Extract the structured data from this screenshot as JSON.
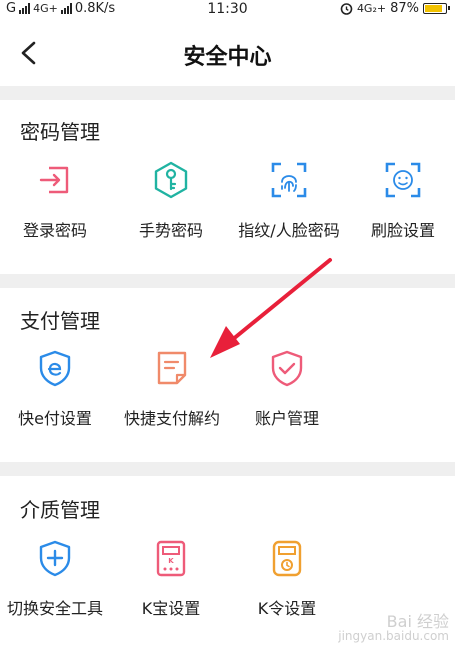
{
  "status": {
    "left_text": "G",
    "network": "4G+",
    "speed": "0.8K/s",
    "time": "11:30",
    "network_right": "4G₂+",
    "battery": "87%",
    "battery_level": 0.87
  },
  "header": {
    "title": "安全中心"
  },
  "sections": [
    {
      "title": "密码管理",
      "items": [
        {
          "label": "登录密码",
          "icon": "login-icon",
          "color": "#ee5b79"
        },
        {
          "label": "手势密码",
          "icon": "key-icon",
          "color": "#20b3a2"
        },
        {
          "label": "指纹/人脸密码",
          "icon": "fingerprint-icon",
          "color": "#2b8be8"
        },
        {
          "label": "刷脸设置",
          "icon": "face-icon",
          "color": "#2b8be8"
        }
      ]
    },
    {
      "title": "支付管理",
      "items": [
        {
          "label": "快e付设置",
          "icon": "e-pay-icon",
          "color": "#2b8be8"
        },
        {
          "label": "快捷支付解约",
          "icon": "document-icon",
          "color": "#f08a6a"
        },
        {
          "label": "账户管理",
          "icon": "shield-check-icon",
          "color": "#ee5b79"
        }
      ]
    },
    {
      "title": "介质管理",
      "items": [
        {
          "label": "切换安全工具",
          "icon": "shield-plus-icon",
          "color": "#2b8be8"
        },
        {
          "label": "K宝设置",
          "icon": "kbao-icon",
          "color": "#ee5b79"
        },
        {
          "label": "K令设置",
          "icon": "kling-icon",
          "color": "#f0a030"
        }
      ]
    }
  ],
  "annotation": {
    "color": "#e8203a"
  },
  "watermark": {
    "line1": "Bai 经验",
    "line2": "jingyan.baidu.com"
  }
}
